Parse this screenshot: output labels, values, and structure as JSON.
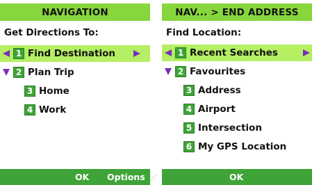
{
  "left": {
    "title": "NAVIGATION",
    "prompt": "Get Directions To:",
    "items": [
      {
        "num": "1",
        "label": "Find Destination"
      },
      {
        "num": "2",
        "label": "Plan Trip"
      },
      {
        "num": "3",
        "label": "Home"
      },
      {
        "num": "4",
        "label": "Work"
      }
    ],
    "softkeys": {
      "ok": "OK",
      "options": "Options"
    }
  },
  "right": {
    "title": "NAV... > END ADDRESS",
    "prompt": "Find Location:",
    "items": [
      {
        "num": "1",
        "label": "Recent Searches"
      },
      {
        "num": "2",
        "label": "Favourites"
      },
      {
        "num": "3",
        "label": "Address"
      },
      {
        "num": "4",
        "label": "Airport"
      },
      {
        "num": "5",
        "label": "Intersection"
      },
      {
        "num": "6",
        "label": "My GPS Location"
      }
    ],
    "softkeys": {
      "ok": "OK"
    }
  },
  "colors": {
    "title_bg": "#86d63c",
    "selected_bg": "#b4ef64",
    "number_bg": "#3fa437",
    "softbar_bg": "#3fa437",
    "arrow": "#7a2fb5"
  },
  "icons": [
    "left-arrow-icon",
    "right-arrow-icon",
    "expand-down-icon"
  ]
}
